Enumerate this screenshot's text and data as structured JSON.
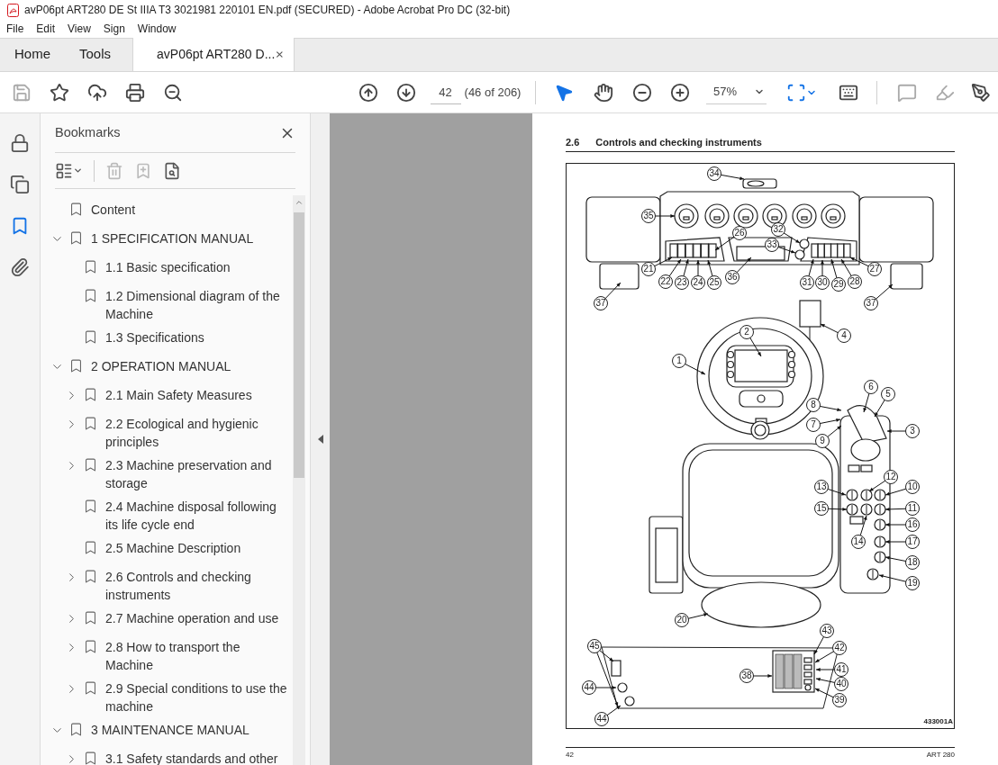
{
  "window": {
    "title": "avP06pt ART280 DE St IIIA T3 3021981 220101 EN.pdf (SECURED) - Adobe Acrobat Pro DC (32-bit)"
  },
  "menu": [
    "File",
    "Edit",
    "View",
    "Sign",
    "Window"
  ],
  "tabs": [
    {
      "label": "Home",
      "kind": "nav",
      "selected": false
    },
    {
      "label": "Tools",
      "kind": "nav",
      "selected": false
    },
    {
      "label": "avP06pt ART280 D...",
      "kind": "document",
      "selected": true
    }
  ],
  "toolbar": {
    "page_number": "42",
    "page_count": "(46 of 206)",
    "zoom": "57%",
    "tools": [
      {
        "kind": "select",
        "selected": true
      },
      {
        "kind": "hand",
        "selected": false
      }
    ]
  },
  "side_rail": [
    {
      "kind": "lock",
      "selected": false
    },
    {
      "kind": "pages",
      "selected": false
    },
    {
      "kind": "bookmarks",
      "selected": true
    },
    {
      "kind": "attachments",
      "selected": false
    }
  ],
  "bookmarks": {
    "title": "Bookmarks",
    "items": [
      {
        "label": "Content"
      },
      {
        "label": "1 SPECIFICATION MANUAL",
        "expanded": true,
        "children": [
          {
            "label": "1.1 Basic specification"
          },
          {
            "label": "1.2 Dimensional diagram of the Machine"
          },
          {
            "label": "1.3 Specifications"
          }
        ]
      },
      {
        "label": "2 OPERATION MANUAL",
        "expanded": true,
        "children": [
          {
            "label": "2.1 Main Safety Measures",
            "expanded": false
          },
          {
            "label": "2.2 Ecological and hygienic principles",
            "expanded": false
          },
          {
            "label": "2.3 Machine preservation and storage",
            "expanded": false
          },
          {
            "label": "2.4 Machine disposal following its life cycle end"
          },
          {
            "label": "2.5 Machine Description"
          },
          {
            "label": "2.6 Controls and checking instruments",
            "expanded": false
          },
          {
            "label": "2.7 Machine operation and use",
            "expanded": false
          },
          {
            "label": "2.8 How to transport the Machine",
            "expanded": false
          },
          {
            "label": "2.9 Special conditions to use the machine",
            "expanded": false
          }
        ]
      },
      {
        "label": "3 MAINTENANCE MANUAL",
        "expanded": true,
        "children": [
          {
            "label": "3.1 Safety standards and other",
            "expanded": false
          }
        ]
      }
    ]
  },
  "document": {
    "section_number": "2.6",
    "section_title": "Controls and checking instruments",
    "figure": {
      "figure_id": "433001A",
      "callouts": [
        {
          "label": "34"
        },
        {
          "label": "35"
        },
        {
          "label": "26"
        },
        {
          "label": "32"
        },
        {
          "label": "33"
        },
        {
          "label": "21"
        },
        {
          "label": "22"
        },
        {
          "label": "23"
        },
        {
          "label": "24"
        },
        {
          "label": "25"
        },
        {
          "label": "36"
        },
        {
          "label": "31"
        },
        {
          "label": "30"
        },
        {
          "label": "29"
        },
        {
          "label": "28"
        },
        {
          "label": "27"
        },
        {
          "label": "37"
        },
        {
          "label": "37"
        },
        {
          "label": "4"
        },
        {
          "label": "2"
        },
        {
          "label": "1"
        },
        {
          "label": "6"
        },
        {
          "label": "5"
        },
        {
          "label": "8"
        },
        {
          "label": "7"
        },
        {
          "label": "9"
        },
        {
          "label": "3"
        },
        {
          "label": "12"
        },
        {
          "label": "13"
        },
        {
          "label": "10"
        },
        {
          "label": "15"
        },
        {
          "label": "11"
        },
        {
          "label": "16"
        },
        {
          "label": "14"
        },
        {
          "label": "17"
        },
        {
          "label": "18"
        },
        {
          "label": "19"
        },
        {
          "label": "20"
        },
        {
          "label": "43"
        },
        {
          "label": "45"
        },
        {
          "label": "42"
        },
        {
          "label": "41"
        },
        {
          "label": "38"
        },
        {
          "label": "40"
        },
        {
          "label": "39"
        },
        {
          "label": "44"
        },
        {
          "label": "44"
        }
      ]
    },
    "footer": {
      "page": "42",
      "model": "ART 280"
    }
  }
}
